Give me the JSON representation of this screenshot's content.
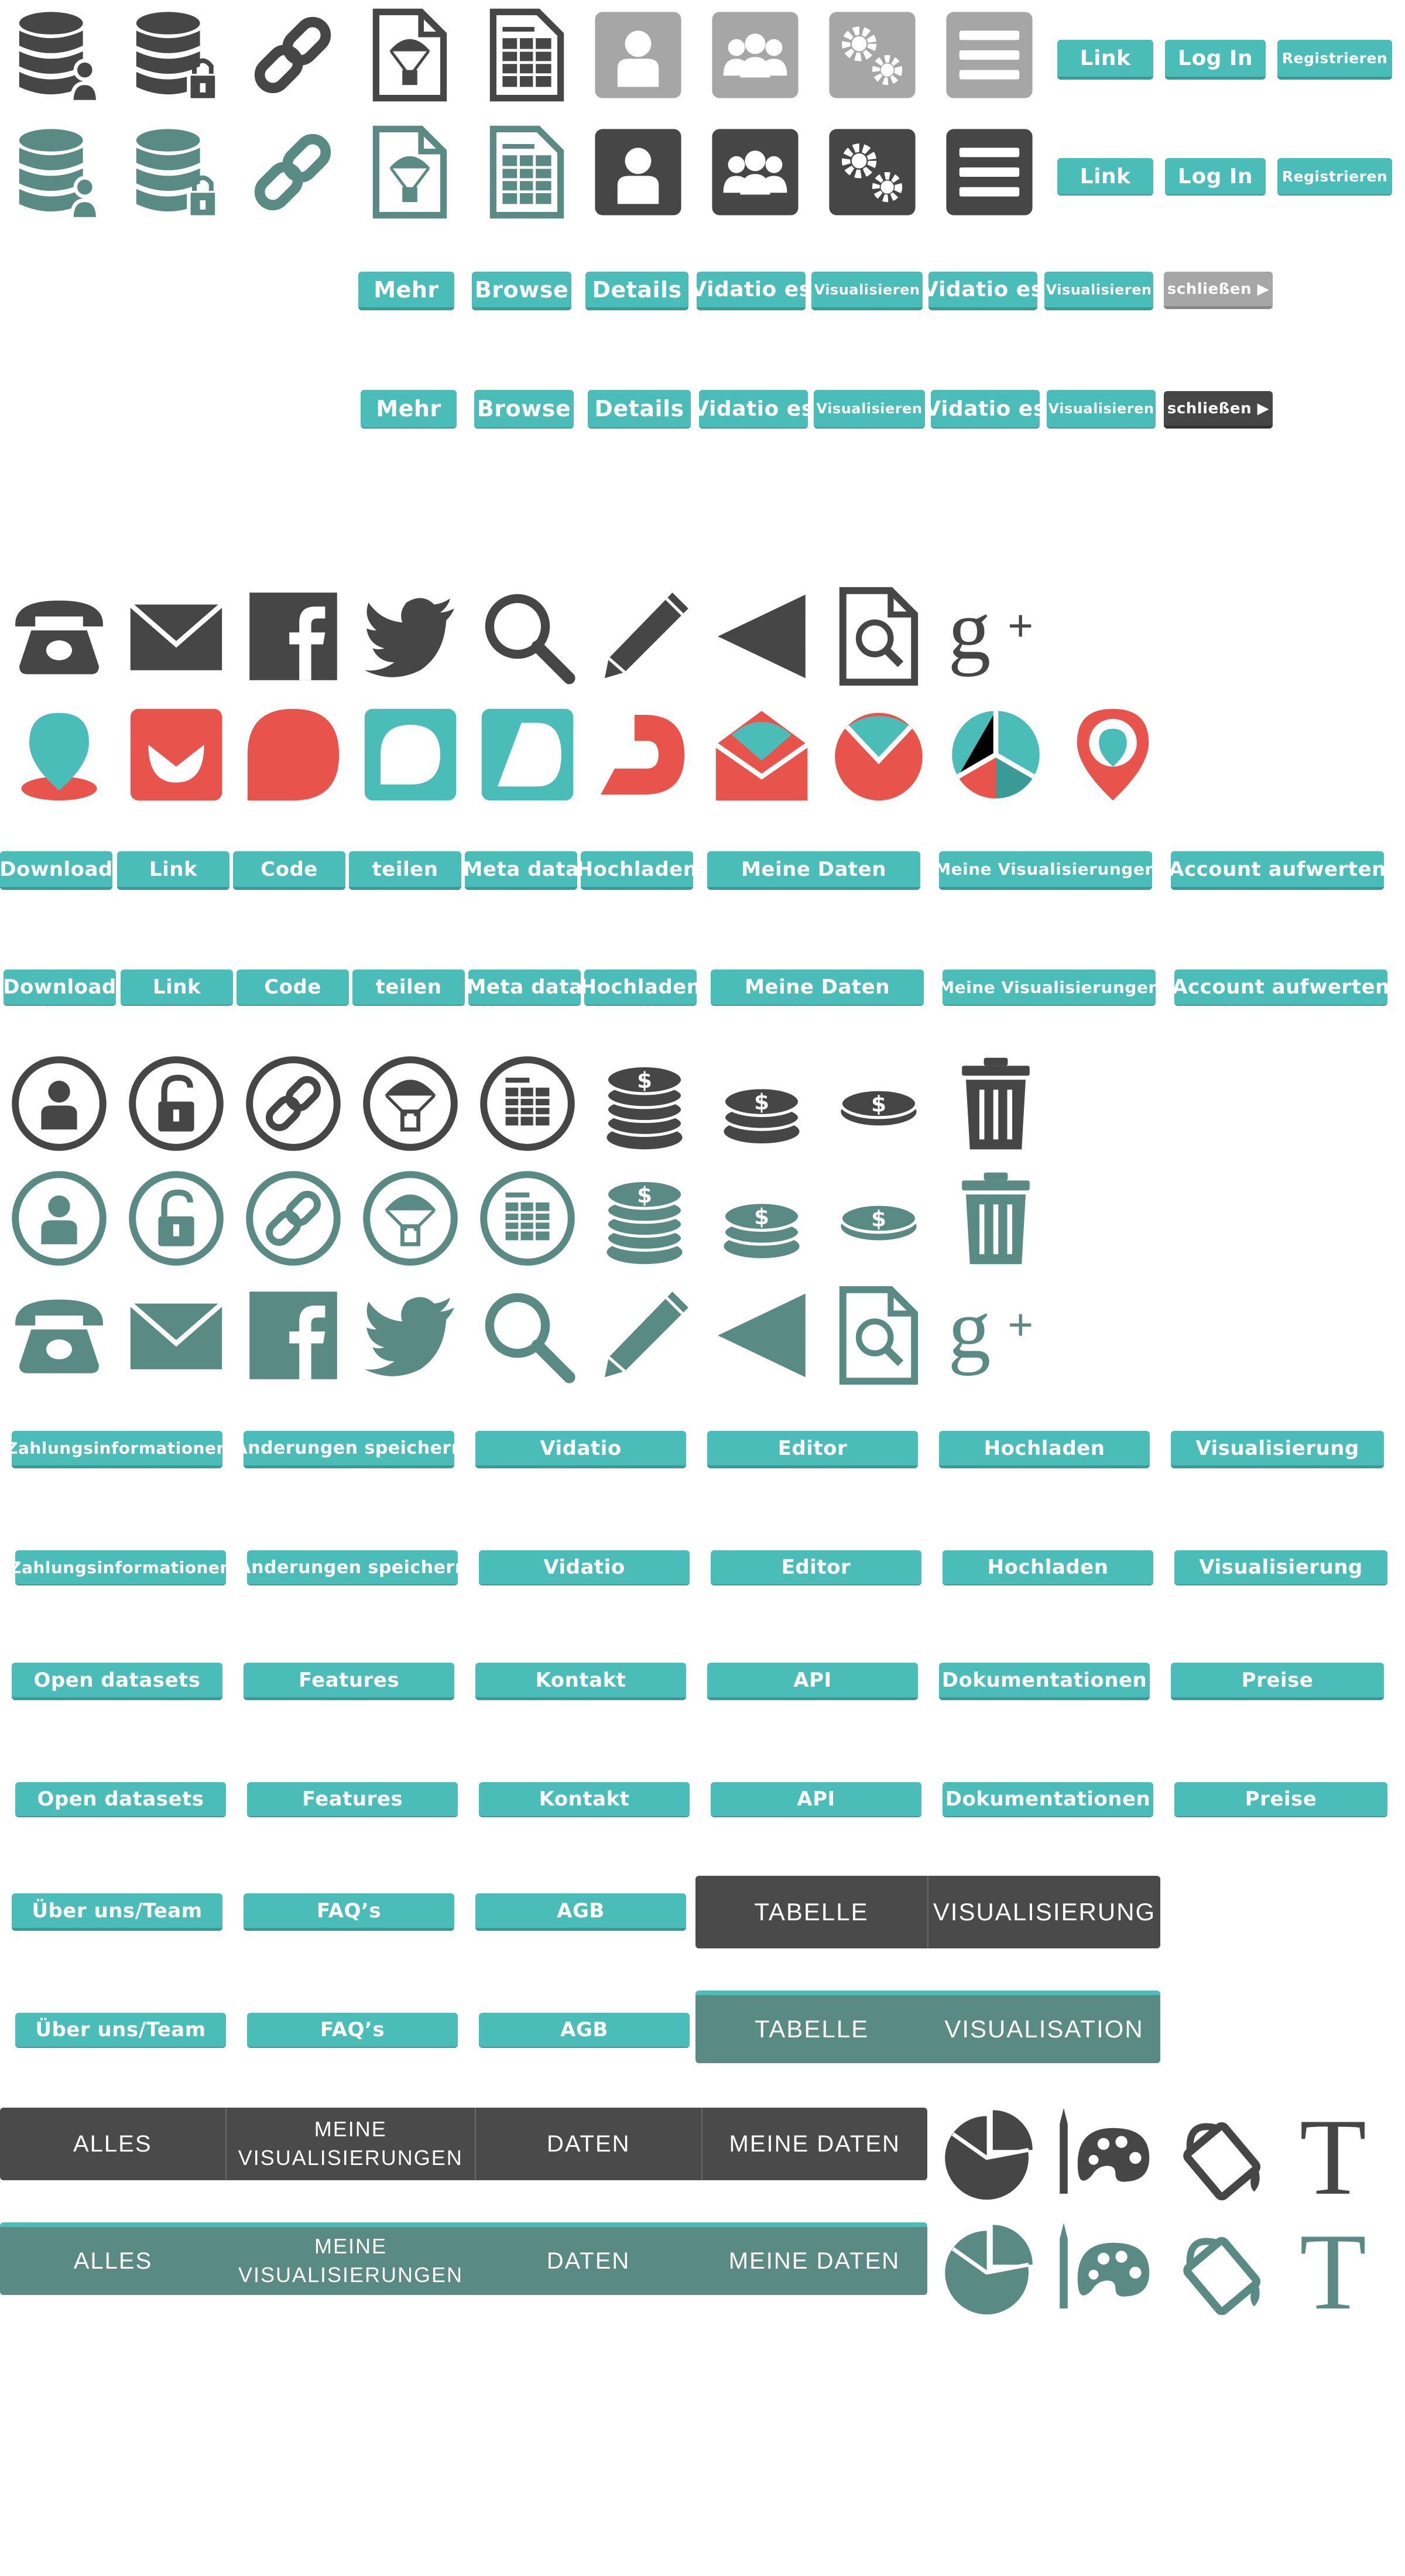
{
  "colors": {
    "dark": "#464646",
    "gray": "#a6a6a6",
    "teal": "#4bbdb8",
    "slate": "#5a8a84",
    "red": "#e8534c"
  },
  "icons": {
    "row1": [
      "database-user-icon",
      "database-lock-icon",
      "link-icon",
      "file-parachute-icon",
      "file-table-icon",
      "user-tile-icon",
      "group-tile-icon",
      "settings-tile-icon",
      "menu-tile-icon"
    ],
    "row2": [
      "database-user-icon",
      "database-lock-icon",
      "link-icon",
      "file-parachute-icon",
      "file-table-icon",
      "user-tile-icon",
      "group-tile-icon",
      "settings-tile-icon",
      "menu-tile-icon"
    ],
    "social": [
      "phone-icon",
      "mail-icon",
      "facebook-icon",
      "twitter-icon",
      "search-icon",
      "pencil-icon",
      "triangle-left-icon",
      "file-search-icon",
      "google-plus-icon"
    ],
    "logos": [
      "pin-logo-icon",
      "ring-logo-icon",
      "bubble-red-icon",
      "bubble-teal-icon",
      "tile-d-icon",
      "arc-logo-icon",
      "envelope-chart-icon",
      "circle-chart-icon",
      "pie-tri-icon",
      "map-pin-icon"
    ],
    "circles": [
      "user-circle-icon",
      "lock-circle-icon",
      "link-circle-icon",
      "parachute-circle-icon",
      "table-circle-icon",
      "coins-stack-icon",
      "coins-pile-icon",
      "coin-icon",
      "trash-icon"
    ],
    "tools": [
      "pie-chart-icon",
      "palette-icon",
      "paint-bucket-icon",
      "text-T-icon"
    ]
  },
  "buttons": {
    "top": {
      "link": "Link",
      "login": "Log In",
      "register": "Registrieren"
    },
    "row3": [
      "Mehr",
      "Browse",
      "Details",
      "Vidatio es",
      "Visualisieren",
      "Vidatio es",
      "Visualisieren"
    ],
    "close": "schließen ▶",
    "menu": [
      "Download",
      "Link",
      "Code",
      "teilen",
      "Meta data",
      "Hochladen",
      "Meine Daten",
      "Meine Visualisierungen",
      "Account aufwerten"
    ],
    "app": [
      "Zahlungsinformationen",
      "Änderungen speichern",
      "Vidatio",
      "Editor",
      "Hochladen",
      "Visualisierung"
    ],
    "site": [
      "Open datasets",
      "Features",
      "Kontakt",
      "API",
      "Dokumentationen",
      "Preise"
    ],
    "footer": [
      "Über uns/Team",
      "FAQ’s",
      "AGB"
    ]
  },
  "tabs": {
    "a": [
      "TABELLE",
      "VISUALISIERUNG"
    ],
    "b": [
      "TABELLE",
      "VISUALISATION"
    ],
    "filter": [
      "ALLES",
      "MEINE VISUALISIERUNGEN",
      "DATEN",
      "MEINE DATEN"
    ]
  }
}
